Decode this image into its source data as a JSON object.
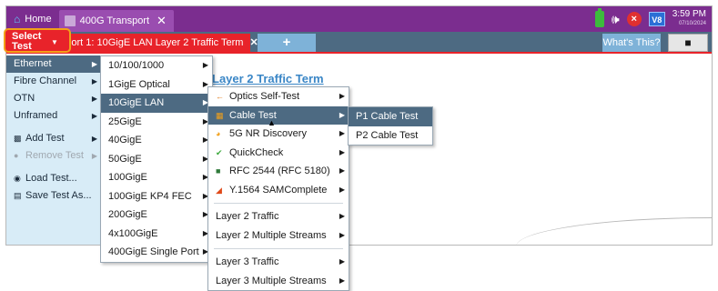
{
  "titlebar": {
    "home_label": "Home",
    "tab_label": "400G Transport",
    "tab_close": "✕",
    "vnc_label": "V8",
    "time": "3:59 PM",
    "date": "07/10/2024"
  },
  "testbar": {
    "select_line1": "Select",
    "select_line2": "Test",
    "port_tab_label": "Port 1: 10GigE LAN Layer 2 Traffic Term",
    "port_tab_close": "✕",
    "add_tab_label": "+",
    "whats_this_label": "What's This?"
  },
  "sidebar": {
    "items": [
      {
        "label": "Ethernet"
      },
      {
        "label": "Fibre Channel"
      },
      {
        "label": "OTN"
      },
      {
        "label": "Unframed"
      },
      {
        "label": "Add Test"
      },
      {
        "label": "Remove Test"
      },
      {
        "label": "Load Test..."
      },
      {
        "label": "Save Test As..."
      }
    ]
  },
  "content": {
    "title": "Layer 2 Traffic Term"
  },
  "menu_rates": {
    "items": [
      {
        "label": "10/100/1000"
      },
      {
        "label": "1GigE Optical"
      },
      {
        "label": "10GigE LAN"
      },
      {
        "label": "25GigE"
      },
      {
        "label": "40GigE"
      },
      {
        "label": "50GigE"
      },
      {
        "label": "100GigE"
      },
      {
        "label": "100GigE KP4 FEC"
      },
      {
        "label": "200GigE"
      },
      {
        "label": "4x100GigE"
      },
      {
        "label": "400GigE Single Port"
      }
    ]
  },
  "menu_apps": {
    "items": [
      {
        "label": "Optics Self-Test",
        "icon": "optics-icon"
      },
      {
        "label": "Cable Test",
        "icon": "cable-icon"
      },
      {
        "label": "5G NR Discovery",
        "icon": "discovery-icon"
      },
      {
        "label": "QuickCheck",
        "icon": "check-icon"
      },
      {
        "label": "RFC 2544 (RFC 5180)",
        "icon": "rfc-icon"
      },
      {
        "label": "Y.1564 SAMComplete",
        "icon": "sam-icon"
      },
      {
        "label": "Layer 2 Traffic"
      },
      {
        "label": "Layer 2 Multiple Streams"
      },
      {
        "label": "Layer 3 Traffic"
      },
      {
        "label": "Layer 3 Multiple Streams"
      }
    ]
  },
  "menu_cable": {
    "items": [
      {
        "label": "P1 Cable Test"
      },
      {
        "label": "P2 Cable Test"
      }
    ]
  },
  "colors": {
    "titlebar": "#7b2d8f",
    "testbar": "#4d6a82",
    "accent_red": "#e8232a",
    "highlight_orange": "#f2a01a",
    "sidebar_bg": "#d8ecf7",
    "link_blue": "#3a86c6"
  }
}
